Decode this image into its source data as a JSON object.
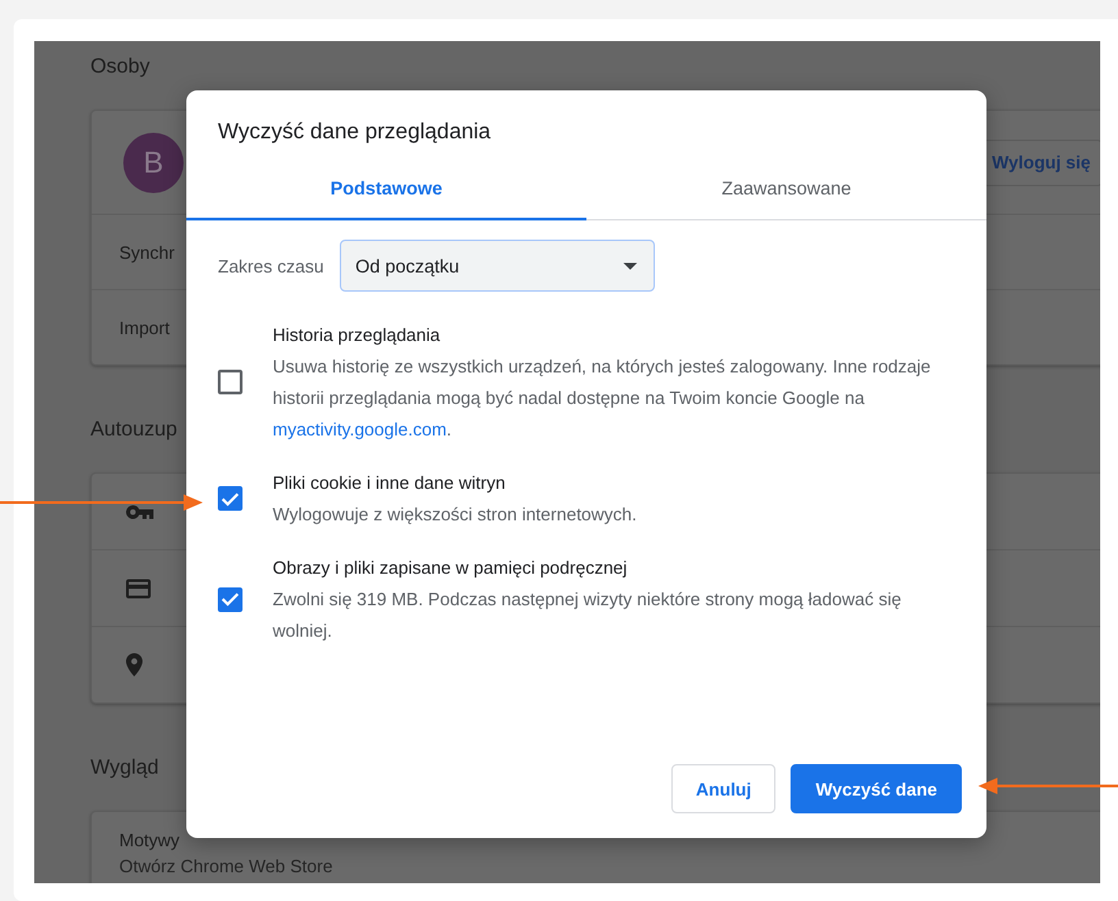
{
  "background_page": {
    "sections": [
      {
        "title": "Osoby",
        "rows": [
          {
            "kind": "account",
            "avatar": "B",
            "action": "Wyloguj się"
          },
          {
            "kind": "text",
            "label": "Synchr"
          },
          {
            "kind": "text",
            "label": "Import"
          }
        ]
      },
      {
        "title": "Autouzup",
        "rows": [
          {
            "kind": "icon"
          },
          {
            "kind": "icon"
          },
          {
            "kind": "icon"
          }
        ]
      },
      {
        "title": "Wygląd",
        "rows": [
          {
            "kind": "theme",
            "label": "Motywy",
            "subtitle": "Otwórz Chrome Web Store"
          }
        ]
      }
    ]
  },
  "dialog": {
    "title": "Wyczyść dane przeglądania",
    "tabs": [
      {
        "label": "Podstawowe",
        "selected": true
      },
      {
        "label": "Zaawansowane",
        "selected": false
      }
    ],
    "time_range": {
      "label": "Zakres czasu",
      "value": "Od początku"
    },
    "items": [
      {
        "title": "Historia przeglądania",
        "description": "Usuwa historię ze wszystkich urządzeń, na których jesteś zalogowany. Inne rodzaje historii przeglądania mogą być nadal dostępne na Twoim koncie Google na",
        "link": "myactivity.google.com",
        "suffix": ".",
        "checked": false
      },
      {
        "title": "Pliki cookie i inne dane witryn",
        "description": "Wylogowuje z większości stron internetowych.",
        "checked": true
      },
      {
        "title": "Obrazy i pliki zapisane w pamięci podręcznej",
        "description": "Zwolni się 319 MB. Podczas następnej wizyty niektóre strony mogą ładować się wolniej.",
        "checked": true
      }
    ],
    "buttons": [
      {
        "label": "Anuluj",
        "kind": "secondary"
      },
      {
        "label": "Wyczyść dane",
        "kind": "primary"
      }
    ]
  }
}
